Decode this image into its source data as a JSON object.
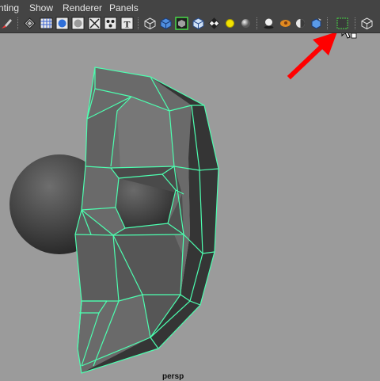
{
  "menubar": {
    "items": [
      "nting",
      "Show",
      "Renderer",
      "Panels"
    ]
  },
  "toolbar": {
    "icons": [
      "paint-brush-icon",
      "wireframe-on-shaded-icon",
      "grid-icon",
      "smooth-shade-all-icon",
      "flat-shade-icon",
      "wireframe-x-icon",
      "lights-icon",
      "texture-text-icon",
      "cube-wireframe-icon",
      "cube-shaded-icon",
      "isolate-select-icon",
      "cube-flat-icon",
      "checker-icon",
      "yellow-light-icon",
      "grey-sphere-icon",
      "shadow-sphere-icon",
      "motion-blur-icon",
      "half-sphere-icon",
      "blue-cube-icon",
      "select-region-icon",
      "camera-cube-icon"
    ]
  },
  "viewport": {
    "camera_label": "persp"
  },
  "colors": {
    "background": "#9b9b9b",
    "wireframe": "#4dffb0",
    "annotation_arrow": "#ff0000"
  }
}
